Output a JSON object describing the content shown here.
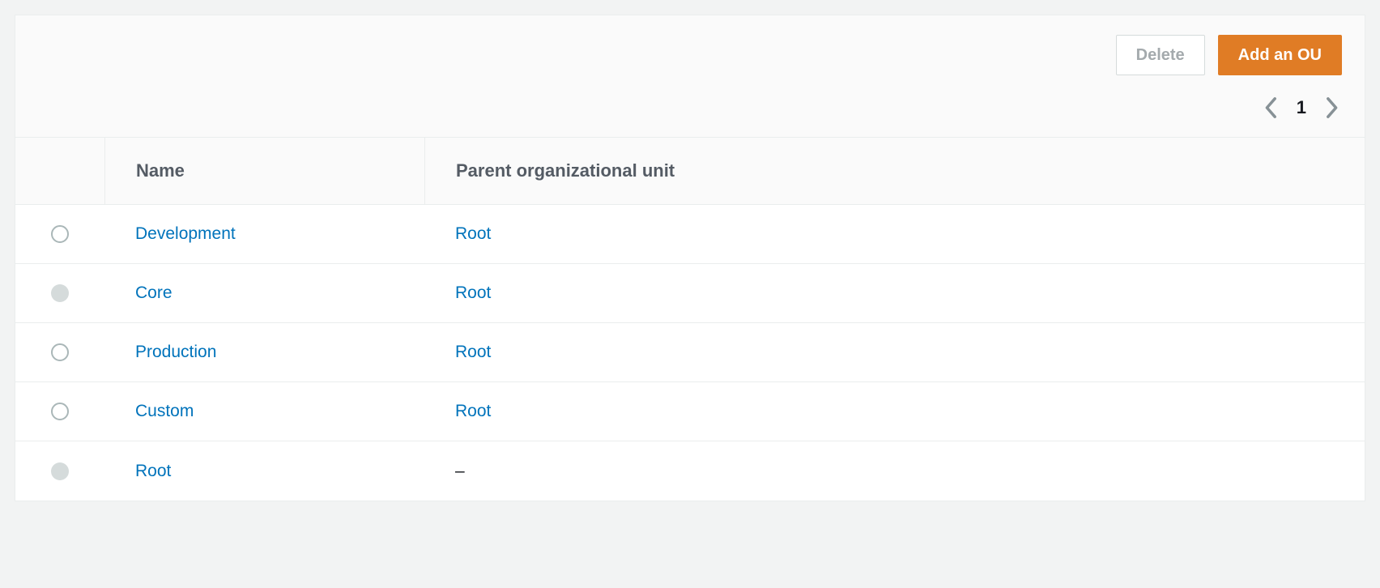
{
  "actions": {
    "delete_label": "Delete",
    "add_ou_label": "Add an OU"
  },
  "pagination": {
    "current_page": "1"
  },
  "table": {
    "headers": {
      "name": "Name",
      "parent": "Parent organizational unit"
    },
    "rows": [
      {
        "name": "Development",
        "parent": "Root",
        "selectable": true
      },
      {
        "name": "Core",
        "parent": "Root",
        "selectable": false
      },
      {
        "name": "Production",
        "parent": "Root",
        "selectable": true
      },
      {
        "name": "Custom",
        "parent": "Root",
        "selectable": true
      },
      {
        "name": "Root",
        "parent": "–",
        "selectable": false
      }
    ]
  }
}
